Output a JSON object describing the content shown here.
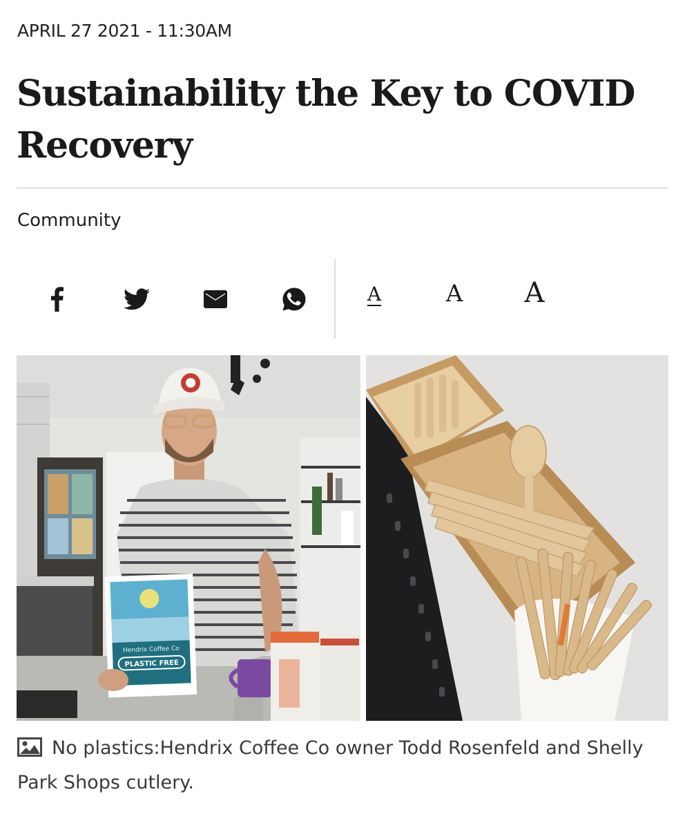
{
  "article": {
    "dateline": "APRIL 27 2021 - 11:30AM",
    "headline": "Sustainability the Key to COVID Recovery",
    "category": "Community"
  },
  "share": [
    {
      "name": "facebook",
      "icon": "facebook-icon"
    },
    {
      "name": "twitter",
      "icon": "twitter-icon"
    },
    {
      "name": "email",
      "icon": "mail-icon"
    },
    {
      "name": "whatsapp",
      "icon": "whatsapp-icon"
    }
  ],
  "font_size": {
    "small_label": "A",
    "medium_label": "A",
    "large_label": "A",
    "selected": "small"
  },
  "photo_sign": {
    "line1": "Hendrix Coffee Co",
    "line2": "PLASTIC FREE"
  },
  "caption": {
    "icon": "image-icon",
    "text": "No plastics:Hendrix Coffee Co owner Todd Rosenfeld and Shelly Park Shops cutlery."
  }
}
